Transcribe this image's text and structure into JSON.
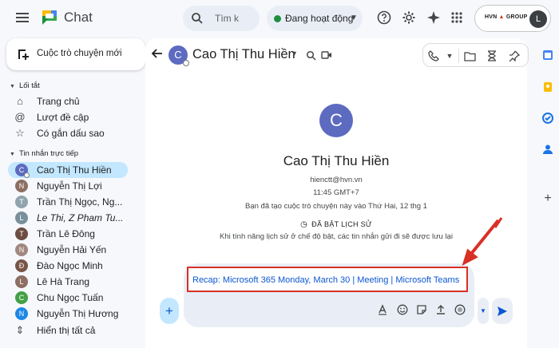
{
  "app": {
    "title": "Chat"
  },
  "search": {
    "placeholder": "Tìm k"
  },
  "status": {
    "label": "Đang hoạt động"
  },
  "account": {
    "brand_left": "HVN",
    "brand_right": "GROUP",
    "avatar_letter": "L"
  },
  "sidebar": {
    "new_chat_label": "Cuộc trò chuyện mới",
    "shortcuts_heading": "Lối tắt",
    "shortcuts": [
      {
        "label": "Trang chủ",
        "icon": "home-icon"
      },
      {
        "label": "Lượt đề cập",
        "icon": "at-icon"
      },
      {
        "label": "Có gắn dấu sao",
        "icon": "star-icon"
      }
    ],
    "dm_heading": "Tin nhắn trực tiếp",
    "dms": [
      {
        "label": "Cao Thị Thu Hiền",
        "letter": "C",
        "color": "#5c6bc0",
        "active": true
      },
      {
        "label": "Nguyễn Thị Lợi",
        "letter": "N",
        "color": "#8d6e63"
      },
      {
        "label": "Trần Thị Ngọc, Ng...",
        "letter": "T",
        "color": "#90a4ae"
      },
      {
        "label": "Le Thi, Z Pham Tu...",
        "letter": "L",
        "color": "#78909c",
        "italic": true
      },
      {
        "label": "Trần Lê Đông",
        "letter": "T",
        "color": "#6d4c41"
      },
      {
        "label": "Nguyễn Hải Yến",
        "letter": "N",
        "color": "#a1887f"
      },
      {
        "label": "Đào Ngọc Minh",
        "letter": "Đ",
        "color": "#795548"
      },
      {
        "label": "Lê Hà Trang",
        "letter": "L",
        "color": "#8d6e63"
      },
      {
        "label": "Chu Ngọc Tuấn",
        "letter": "C",
        "color": "#43a047"
      },
      {
        "label": "Nguyễn Thị Hương",
        "letter": "N",
        "color": "#1e88e5"
      }
    ],
    "show_all_label": "Hiển thị tất cả"
  },
  "conversation": {
    "name": "Cao Thị Thu Hiền",
    "avatar_letter": "C",
    "email": "hienctt@hvn.vn",
    "time": "11:45 GMT+7",
    "created_note": "Bạn đã tạo cuộc trò chuyện này vào Thứ Hai, 12 thg 1",
    "history_label": "ĐÃ BẬT LỊCH SỬ",
    "history_note": "Khi tính năng lịch sử ở chế độ bật, các tin nhắn gửi đi sẽ được lưu lại"
  },
  "composer": {
    "draft": "Recap: Microsoft 365 Monday, March 30 | Meeting | Microsoft Teams",
    "add_label": "+"
  },
  "colors": {
    "accent": "#0b57d0",
    "highlight": "#d93025",
    "active_bg": "#c2e7ff"
  }
}
